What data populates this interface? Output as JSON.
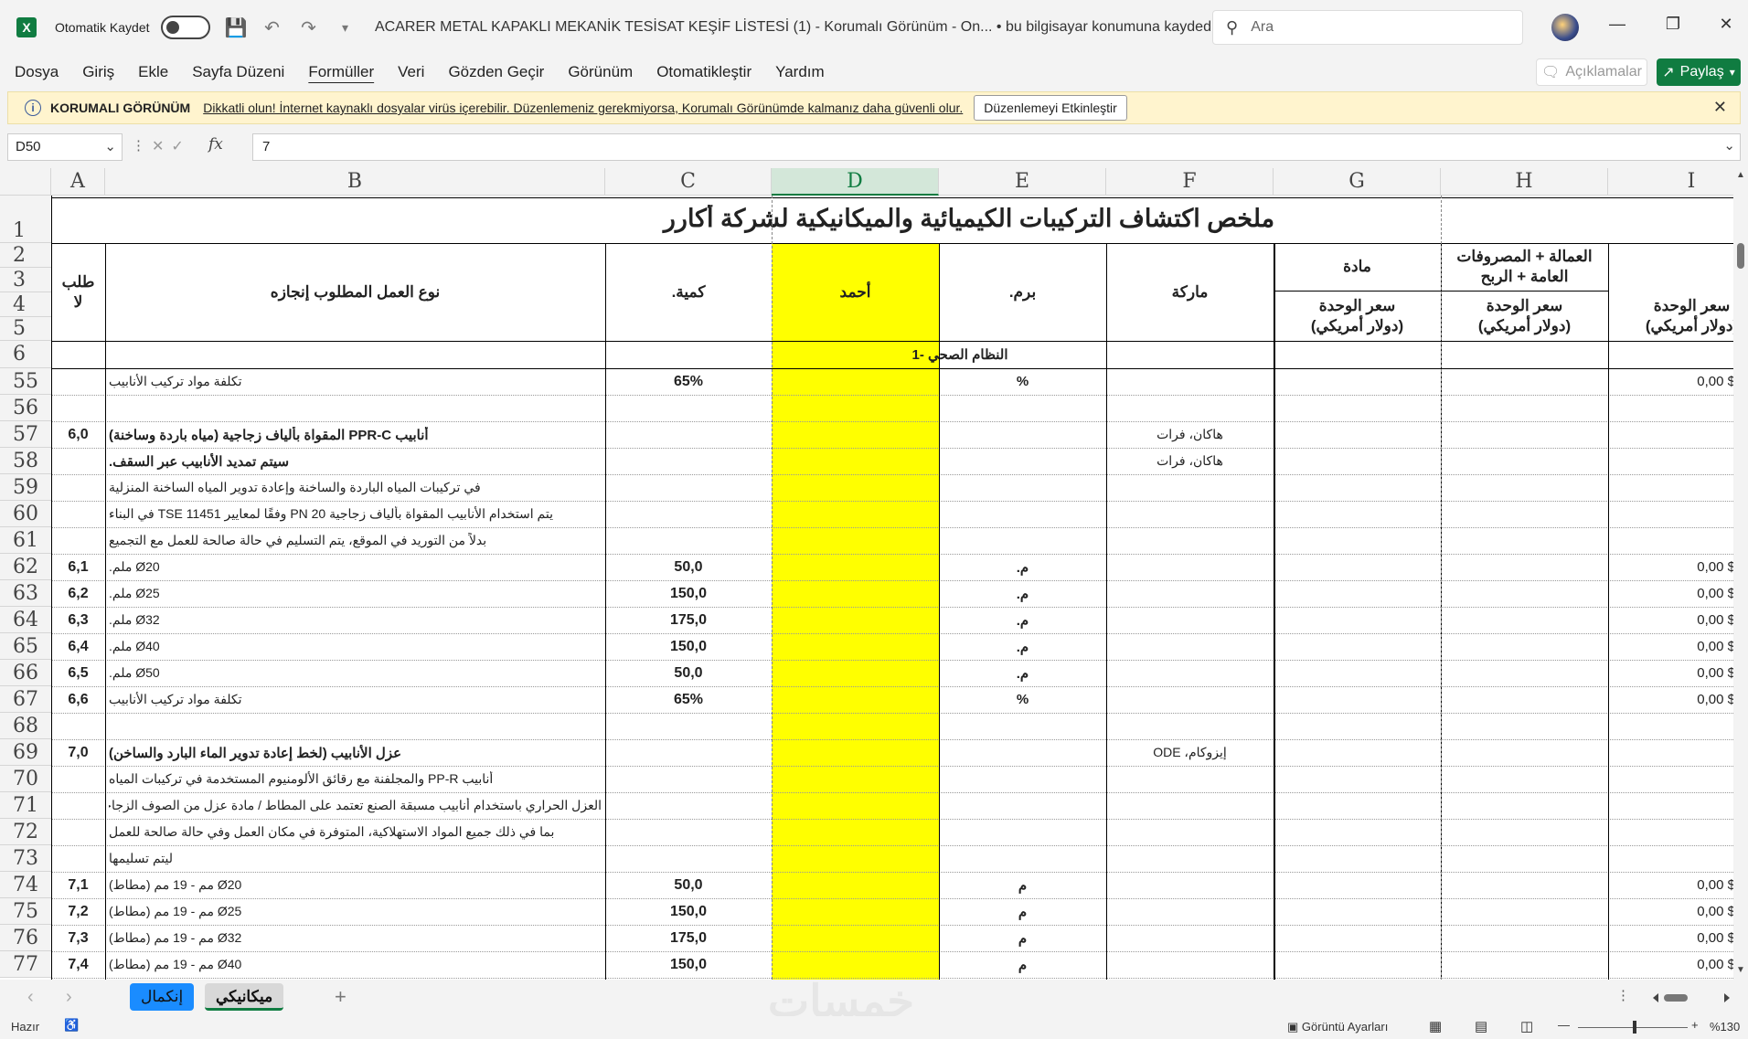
{
  "titlebar": {
    "autosave_label": "Otomatik Kaydet",
    "doc_title": "ACARER METAL KAPAKLI MEKANİK TESİSAT KEŞİF LİSTESİ (1)  -  Korumalı Görünüm  -  On...  •  bu bilgisayar konumuna kaydedildi",
    "search_placeholder": "Ara"
  },
  "menu": [
    "Dosya",
    "Giriş",
    "Ekle",
    "Sayfa Düzeni",
    "Formüller",
    "Veri",
    "Gözden Geçir",
    "Görünüm",
    "Otomatikleştir",
    "Yardım"
  ],
  "menu_active": "Formüller",
  "comments_label": "Açıklamalar",
  "share_label": "Paylaş",
  "protected_view": {
    "title": "KORUMALI GÖRÜNÜM",
    "message": "Dikkatli olun! İnternet kaynaklı dosyalar virüs içerebilir. Düzenlemeniz gerekmiyorsa, Korumalı Görünümde kalmanız daha güvenli olur.",
    "button": "Düzenlemeyi Etkinleştir"
  },
  "formula_bar": {
    "name_box": "D50",
    "value": "7"
  },
  "columns": [
    "A",
    "B",
    "C",
    "D",
    "E",
    "F",
    "G",
    "H",
    "I"
  ],
  "selected_column": "D",
  "header": {
    "title": "ملخص اكتشاف التركيبات الكيميائية والميكانيكية لشركة أكارر",
    "col_a": "طلب\nلا",
    "col_b": "نوع العمل المطلوب إنجازه",
    "col_c": "كمية.",
    "col_d": "أحمد",
    "col_e": "برم.",
    "col_f": "ماركة",
    "col_g_top": "مادة",
    "col_g": "سعر الوحدة\n(دولار أمريكي)",
    "col_h_top": "العمالة + المصروفات\nالعامة + الربح",
    "col_h": "سعر الوحدة\n(دولار أمريكي)",
    "col_i": "سعر الوحدة\n(دولار أمريكي)",
    "section": "النظام الصحي -1"
  },
  "header_rows": [
    "1",
    "2",
    "3",
    "4",
    "5",
    "6"
  ],
  "rows": [
    {
      "n": "55",
      "a": "",
      "b": "تكلفة مواد تركيب الأنابيب",
      "bb": false,
      "c": "65%",
      "e": "%",
      "f": "",
      "i": "0,00 $"
    },
    {
      "n": "56",
      "a": "",
      "b": "",
      "bb": false,
      "c": "",
      "e": "",
      "f": "",
      "i": ""
    },
    {
      "n": "57",
      "a": "6,0",
      "b": "أنابيب PPR-C المقواة بألياف زجاجية (مياه باردة وساخنة)",
      "bb": true,
      "c": "",
      "e": "",
      "f": "هاكان، فرات",
      "i": ""
    },
    {
      "n": "58",
      "a": "",
      "b": "سيتم تمديد الأنابيب عبر السقف.",
      "bb": true,
      "c": "",
      "e": "",
      "f": "هاكان، فرات",
      "i": ""
    },
    {
      "n": "59",
      "a": "",
      "b": "في تركيبات المياه الباردة والساخنة وإعادة تدوير المياه الساخنة المنزلية",
      "bb": false,
      "c": "",
      "e": "",
      "f": "",
      "i": ""
    },
    {
      "n": "60",
      "a": "",
      "b": "يتم استخدام الأنابيب المقواة بألياف زجاجية PN 20 وفقًا لمعايير TSE 11451 في البناء",
      "bb": false,
      "c": "",
      "e": "",
      "f": "",
      "i": ""
    },
    {
      "n": "61",
      "a": "",
      "b": "بدلاً من التوريد في الموقع، يتم التسليم في حالة صالحة للعمل مع التجميع",
      "bb": false,
      "c": "",
      "e": "",
      "f": "",
      "i": ""
    },
    {
      "n": "62",
      "a": "6,1",
      "b": "Ø20 ملم.",
      "bb": false,
      "c": "50,0",
      "e": "م.",
      "f": "",
      "i": "0,00 $"
    },
    {
      "n": "63",
      "a": "6,2",
      "b": "Ø25 ملم.",
      "bb": false,
      "c": "150,0",
      "e": "م.",
      "f": "",
      "i": "0,00 $"
    },
    {
      "n": "64",
      "a": "6,3",
      "b": "Ø32 ملم.",
      "bb": false,
      "c": "175,0",
      "e": "م.",
      "f": "",
      "i": "0,00 $"
    },
    {
      "n": "65",
      "a": "6,4",
      "b": "Ø40 ملم.",
      "bb": false,
      "c": "150,0",
      "e": "م.",
      "f": "",
      "i": "0,00 $"
    },
    {
      "n": "66",
      "a": "6,5",
      "b": "Ø50 ملم.",
      "bb": false,
      "c": "50,0",
      "e": "م.",
      "f": "",
      "i": "0,00 $"
    },
    {
      "n": "67",
      "a": "6,6",
      "b": "تكلفة مواد تركيب الأنابيب",
      "bb": false,
      "c": "65%",
      "e": "%",
      "f": "",
      "i": "0,00 $"
    },
    {
      "n": "68",
      "a": "",
      "b": "",
      "bb": false,
      "c": "",
      "e": "",
      "f": "",
      "i": ""
    },
    {
      "n": "69",
      "a": "7,0",
      "b": "عزل الأنابيب (لخط إعادة تدوير الماء البارد والساخن)",
      "bb": true,
      "c": "",
      "e": "",
      "f": "إيزوكام، ODE",
      "i": ""
    },
    {
      "n": "70",
      "a": "",
      "b": "أنابيب PP-R والمجلفنة مع رقائق الألومنيوم المستخدمة في تركيبات المياه",
      "bb": false,
      "c": "",
      "e": "",
      "f": "",
      "i": ""
    },
    {
      "n": "71",
      "a": "",
      "b": "العزل الحراري باستخدام أنابيب مسبقة الصنع تعتمد على المطاط / مادة عزل من الصوف الزجاجي",
      "bb": false,
      "c": "",
      "e": "",
      "f": "",
      "i": ""
    },
    {
      "n": "72",
      "a": "",
      "b": "بما في ذلك جميع المواد الاستهلاكية، المتوفرة في مكان العمل وفي حالة صالحة للعمل",
      "bb": false,
      "c": "",
      "e": "",
      "f": "",
      "i": ""
    },
    {
      "n": "73",
      "a": "",
      "b": "ليتم تسليمها",
      "bb": false,
      "c": "",
      "e": "",
      "f": "",
      "i": ""
    },
    {
      "n": "74",
      "a": "7,1",
      "b": "Ø20 مم - 19 مم (مطاط)",
      "bb": false,
      "c": "50,0",
      "e": "م",
      "f": "",
      "i": "0,00 $"
    },
    {
      "n": "75",
      "a": "7,2",
      "b": "Ø25 مم - 19 مم (مطاط)",
      "bb": false,
      "c": "150,0",
      "e": "م",
      "f": "",
      "i": "0,00 $"
    },
    {
      "n": "76",
      "a": "7,3",
      "b": "Ø32 مم - 19 مم (مطاط)",
      "bb": false,
      "c": "175,0",
      "e": "م",
      "f": "",
      "i": "0,00 $"
    },
    {
      "n": "77",
      "a": "7,4",
      "b": "Ø40 مم - 19 مم (مطاط)",
      "bb": false,
      "c": "150,0",
      "e": "م",
      "f": "",
      "i": "0,00 $"
    }
  ],
  "sheets": [
    {
      "label": "إنكمال"
    },
    {
      "label": "ميكانيكي"
    }
  ],
  "active_sheet": "ميكانيكي",
  "watermark": "خمسات",
  "status": {
    "ready": "Hazır",
    "view_settings": "Görüntü Ayarları",
    "zoom": "%130"
  },
  "colors": {
    "highlight": "#ffff00",
    "excel_green": "#107c41",
    "info_bar": "#fff4ce"
  }
}
